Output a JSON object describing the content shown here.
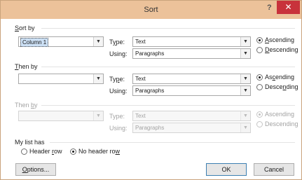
{
  "dialog": {
    "title": "Sort",
    "help": "?",
    "close": "✕"
  },
  "sort_by": {
    "label": "Sort by",
    "column": "Column 1",
    "type_label": "Type:",
    "type_value": "Text",
    "using_label": "Using:",
    "using_value": "Paragraphs",
    "ascending": "Ascending",
    "descending": "Descending",
    "order": "ascending"
  },
  "then_by_1": {
    "label": "Then by",
    "column": "",
    "type_label": "Type:",
    "type_value": "Text",
    "using_label": "Using:",
    "using_value": "Paragraphs",
    "ascending": "Ascending",
    "descending": "Descending",
    "order": "ascending"
  },
  "then_by_2": {
    "label": "Then by",
    "column": "",
    "type_label": "Type:",
    "type_value": "Text",
    "using_label": "Using:",
    "using_value": "Paragraphs",
    "ascending": "Ascending",
    "descending": "Descending",
    "order": "ascending",
    "enabled": false
  },
  "list_has": {
    "label": "My list has",
    "header_row": "Header row",
    "no_header_row": "No header row",
    "selected": "no_header_row"
  },
  "buttons": {
    "options": "Options...",
    "ok": "OK",
    "cancel": "Cancel"
  },
  "colors": {
    "titlebar": "#ecc29a",
    "close": "#c8323b",
    "selection": "#cce0f5"
  }
}
